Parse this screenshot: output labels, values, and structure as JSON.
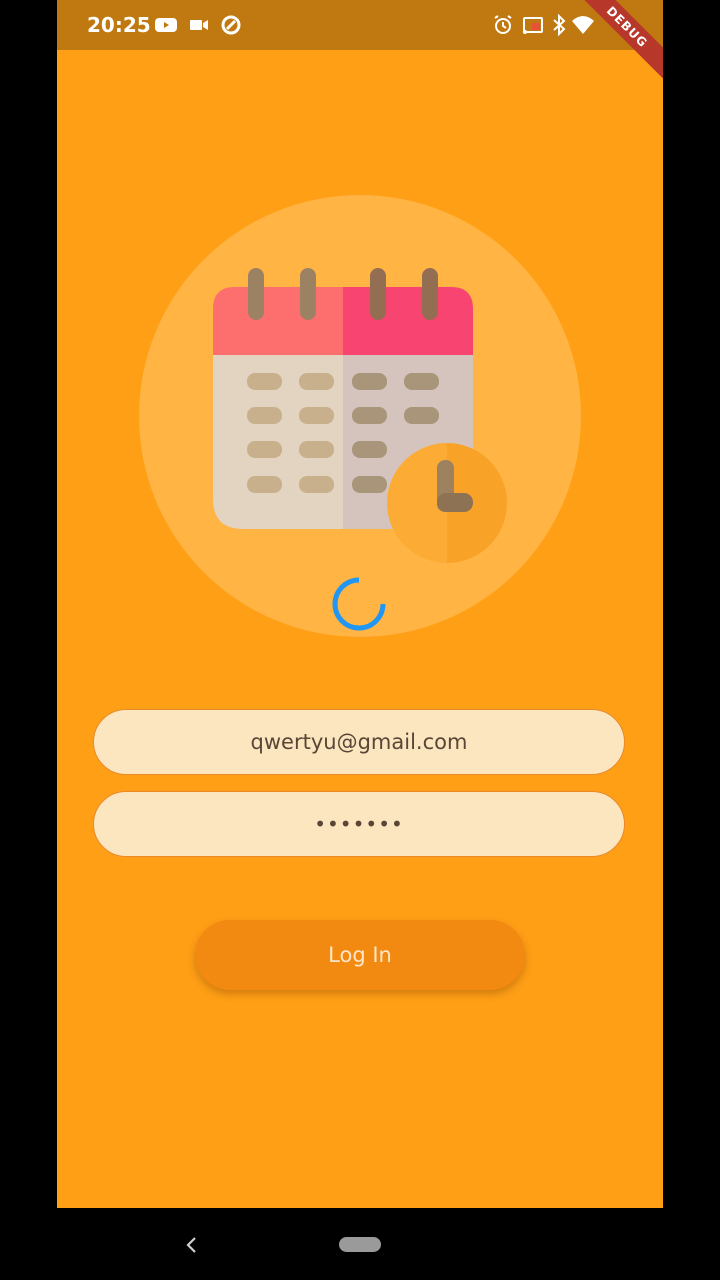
{
  "status_bar": {
    "time": "20:25",
    "icons_left": [
      "youtube-icon",
      "video-camera-icon",
      "sync-icon"
    ],
    "icons_right": [
      "alarm-icon",
      "cast-icon",
      "bluetooth-icon",
      "wifi-icon",
      "battery-icon"
    ],
    "debug_banner": "DEBUG"
  },
  "illustration": {
    "name": "calendar-clock-illustration"
  },
  "login_form": {
    "email_value": "qwertyu@gmail.com",
    "password_value": "•••••••",
    "login_button_label": "Log In"
  },
  "colors": {
    "background": "#ff9f16",
    "status_bar": "#c07810",
    "field_fill": "#fbe6c0",
    "button": "#f28a12",
    "spinner": "#2196f3"
  }
}
